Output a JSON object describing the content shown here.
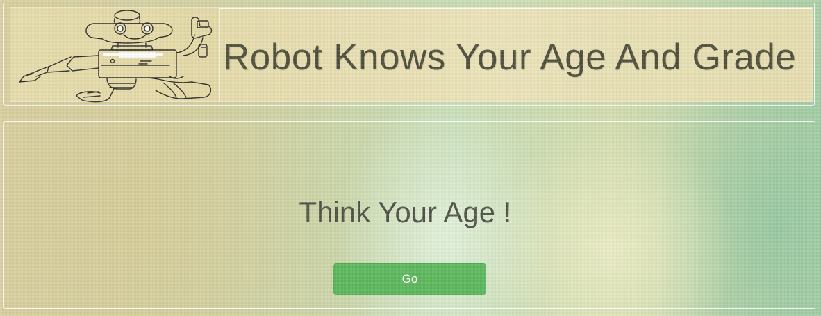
{
  "header": {
    "title": "Robot Knows Your Age And Grade",
    "logo_icon": "robot-icon"
  },
  "main": {
    "prompt": "Think Your Age !",
    "go_button_label": "Go"
  },
  "colors": {
    "button": "#5cb85c",
    "button_text": "#ffffff",
    "title_text": "#4e4e3c",
    "prompt_text": "#4f5147"
  }
}
